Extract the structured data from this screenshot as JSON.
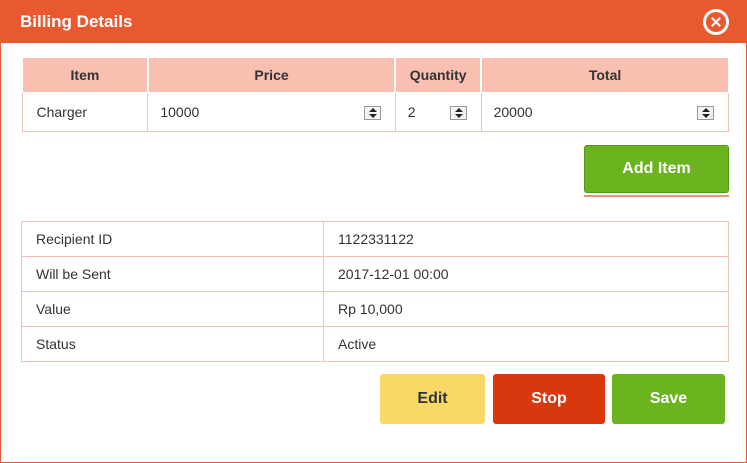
{
  "dialog": {
    "title": "Billing Details",
    "colors": {
      "header": "#e8592f",
      "table_header": "#f9bfb0",
      "add": "#6bb41f",
      "edit": "#f8d866",
      "stop": "#d9380e",
      "save": "#6bb41f"
    },
    "close_icon": "close-circle-icon"
  },
  "items_table": {
    "headers": [
      "Item",
      "Price",
      "Quantity",
      "Total"
    ],
    "rows": [
      {
        "item": "Charger",
        "price": "10000",
        "quantity": "2",
        "total": "20000"
      }
    ]
  },
  "add_item_label": "Add Item",
  "details": [
    {
      "label": "Recipient ID",
      "value": "1122331122"
    },
    {
      "label": "Will be Sent",
      "value": "2017-12-01 00:00"
    },
    {
      "label": "Value",
      "value": "Rp 10,000"
    },
    {
      "label": "Status",
      "value": "Active"
    }
  ],
  "actions": {
    "edit": "Edit",
    "stop": "Stop",
    "save": "Save"
  }
}
